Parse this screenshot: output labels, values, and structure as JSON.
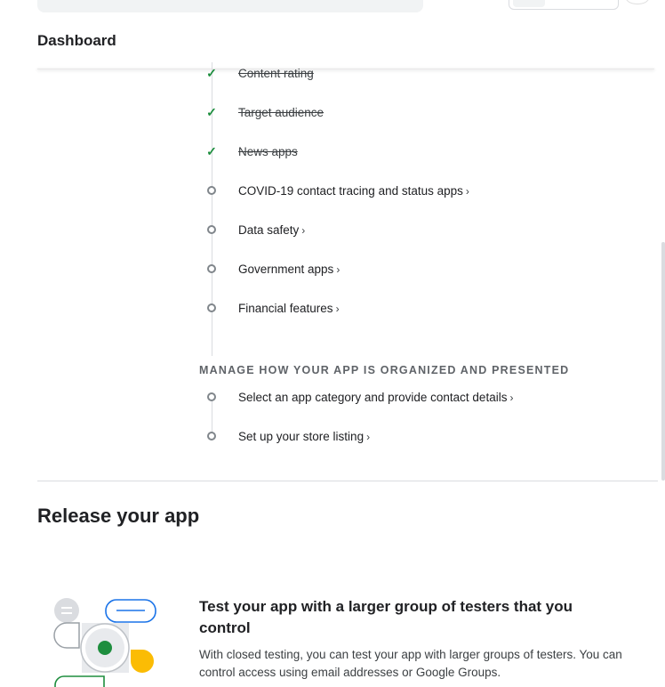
{
  "header": {
    "title": "Dashboard"
  },
  "tasks_completed": [
    {
      "label": "Content rating"
    },
    {
      "label": "Target audience"
    },
    {
      "label": "News apps"
    }
  ],
  "tasks_pending": [
    {
      "label": "COVID-19 contact tracing and status apps"
    },
    {
      "label": "Data safety"
    },
    {
      "label": "Government apps"
    },
    {
      "label": "Financial features"
    }
  ],
  "organize_section": {
    "heading": "MANAGE HOW YOUR APP IS ORGANIZED AND PRESENTED",
    "tasks": [
      {
        "label": "Select an app category and provide contact details"
      },
      {
        "label": "Set up your store listing"
      }
    ]
  },
  "release": {
    "title": "Release your app",
    "card": {
      "title": "Test your app with a larger group of testers that you control",
      "body": "With closed testing, you can test your app with larger groups of testers. You can control access using email addresses or Google Groups."
    }
  },
  "icons": {
    "completed": "check-icon",
    "pending": "circle-icon",
    "link": "chevron-right-icon"
  },
  "colors": {
    "accent_blue": "#1a73e8",
    "success_green": "#1e8e3e",
    "illustration_yellow": "#fbbc04"
  }
}
